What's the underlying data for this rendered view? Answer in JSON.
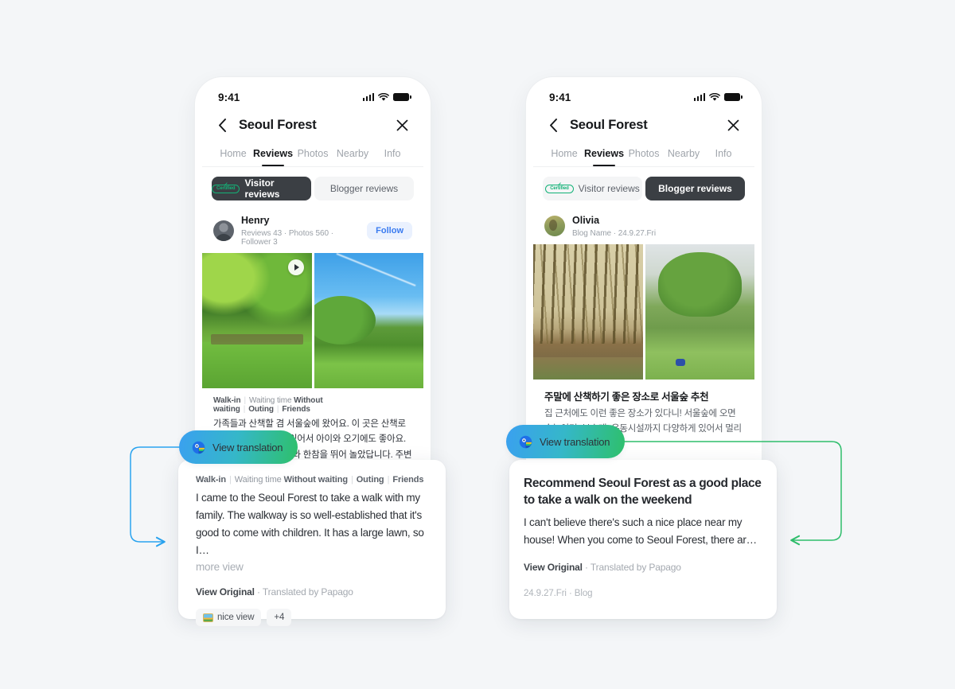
{
  "statusbar": {
    "time": "9:41"
  },
  "nav": {
    "title": "Seoul Forest",
    "back_icon": "chevron-left-icon",
    "close_icon": "close-icon"
  },
  "tabs": [
    {
      "label": "Home",
      "active": false
    },
    {
      "label": "Reviews",
      "active": true
    },
    {
      "label": "Photos",
      "active": false
    },
    {
      "label": "Nearby",
      "active": false
    },
    {
      "label": "Info",
      "active": false
    }
  ],
  "segment": {
    "certified_badge": "Certified",
    "visitor": "Visitor reviews",
    "blogger": "Blogger reviews"
  },
  "left_phone": {
    "author": {
      "name": "Henry",
      "stats": "Reviews 43 · Photos 560 · Follower 3"
    },
    "follow_label": "Follow",
    "tags": {
      "walk_in": "Walk-in",
      "waiting_label": "Waiting time",
      "waiting_value": "Without waiting",
      "outing": "Outing",
      "friends": "Friends"
    },
    "review_korean": "가족들과 산책할 겸 서울숲에 왔어요. 이 곳은 산책로가 너무 잘 조성되어 있어서 아이와 오기에도 좋아요. 잔디밭이 넓어서 아이와 한참을 뛰어 놀았답니다. 주변에는 맛집과 카페도 많아요…"
  },
  "right_phone": {
    "author": {
      "name": "Olivia",
      "stats": "Blog Name · 24.9.27.Fri"
    },
    "blog_title_korean": "주말에 산책하기 좋은 장소로 서울숲 추천",
    "blog_text_korean": "집 근처에도 이런 좋은 장소가 있다니! 서울숲에 오면 숲놀이터, 분수대, 운동시설까지 다양하게 있어서 멀리 가지 않아…"
  },
  "translate_button": {
    "label": "View translation",
    "icon": "papago-parrot-icon"
  },
  "left_card": {
    "tags": {
      "walk_in": "Walk-in",
      "waiting_label": "Waiting time",
      "waiting_value": "Without waiting",
      "outing": "Outing",
      "friends": "Friends"
    },
    "body": "I came to the Seoul Forest to take a walk with my family. The walkway is so well-established that it's good to come with children. It has a large lawn, so I…",
    "more_label": "more view",
    "view_original": "View Original",
    "translated_by": "· Translated by Papago",
    "chip_label": "nice view",
    "chip_more": "+4"
  },
  "right_card": {
    "title": "Recommend Seoul Forest as a good place to take a walk on the weekend",
    "body": "I can't believe there's such a nice place near my house! When you come to Seoul Forest, there ar…",
    "view_original": "View Original",
    "translated_by": "· Translated by Papago",
    "date": "24.9.27.Fri · Blog"
  },
  "colors": {
    "background": "#f4f6f8",
    "accent_blue": "#3aa0f0",
    "accent_green": "#2ec06a",
    "certified_green": "#13b277",
    "follow_blue": "#3a7bf0",
    "dark_segment": "#3b3f44"
  }
}
